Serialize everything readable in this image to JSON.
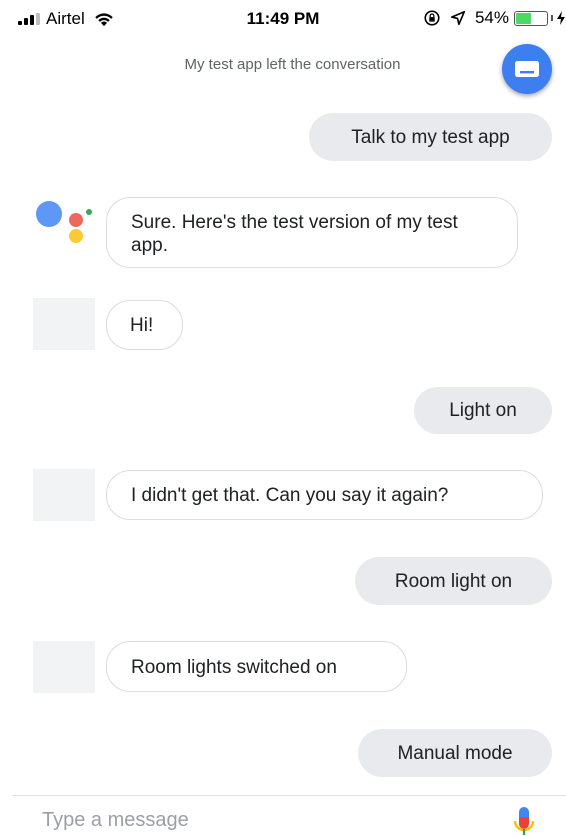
{
  "status_bar": {
    "carrier": "Airtel",
    "time": "11:49 PM",
    "battery_percent": "54%",
    "battery_level": 0.54,
    "icons": [
      "signal-icon",
      "wifi-icon",
      "orientation-lock-icon",
      "location-arrow-icon",
      "battery-icon",
      "charging-icon"
    ]
  },
  "system_note": "My test app left the conversation",
  "keyboard_button_icon": "keyboard-icon",
  "messages": [
    {
      "from": "user",
      "text": "Talk to my test app"
    },
    {
      "from": "assistant",
      "text": "Sure. Here's the test version of my test app."
    },
    {
      "from": "app",
      "text": "Hi!"
    },
    {
      "from": "user",
      "text": "Light on"
    },
    {
      "from": "app",
      "text": "I didn't get that. Can you say it again?"
    },
    {
      "from": "user",
      "text": "Room light on"
    },
    {
      "from": "app",
      "text": "Room lights switched on"
    },
    {
      "from": "user",
      "text": "Manual mode"
    }
  ],
  "input": {
    "placeholder": "Type a message",
    "value": ""
  },
  "mic_icon": "microphone-icon",
  "colors": {
    "accent": "#3d7ff0",
    "user_bubble": "#e8eaed",
    "bot_border": "#dadce0",
    "assistant_blue": "#4285f4",
    "assistant_red": "#ea4335",
    "assistant_yellow": "#fbbc05",
    "assistant_green": "#34a853"
  }
}
